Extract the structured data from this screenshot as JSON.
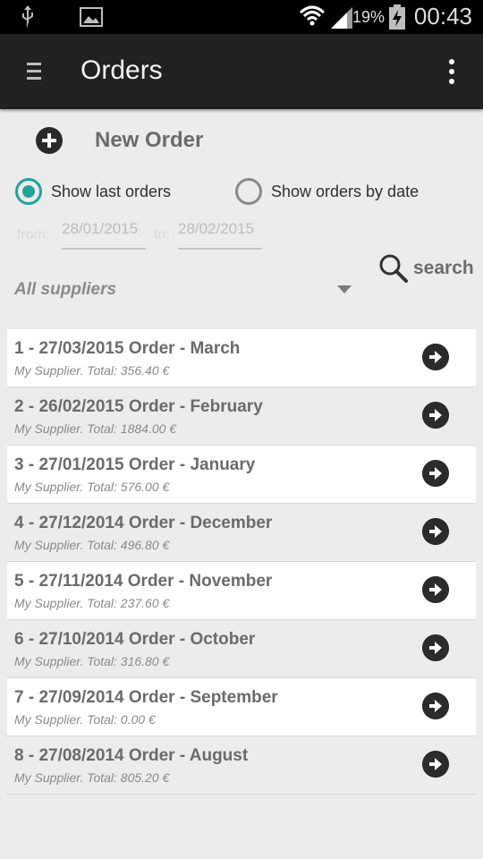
{
  "status_bar": {
    "battery_percent": "19%",
    "time": "00:43",
    "icons": [
      "usb-icon",
      "image-icon",
      "wifi-icon",
      "signal-icon",
      "battery-charging-icon"
    ]
  },
  "action_bar": {
    "title": "Orders",
    "icons": [
      "menu-icon",
      "overflow-menu-icon"
    ]
  },
  "new_order": {
    "label": "New Order",
    "icon": "add-circle-icon"
  },
  "filters": {
    "show_last_label": "Show last orders",
    "show_by_date_label": "Show orders by date",
    "selected": "show_last",
    "from_label": "from:",
    "to_label": "to:",
    "from_value": "28/01/2015",
    "to_value": "28/02/2015",
    "search_label": "search",
    "supplier_value": "All suppliers"
  },
  "colors": {
    "accent": "#21a39a",
    "action_bar": "#212121",
    "background": "#ececec"
  },
  "orders": [
    {
      "title": "1 - 27/03/2015 Order - March",
      "subtitle": "My Supplier. Total: 356.40 €"
    },
    {
      "title": "2 - 26/02/2015 Order - February",
      "subtitle": "My Supplier. Total: 1884.00 €"
    },
    {
      "title": "3 - 27/01/2015 Order - January",
      "subtitle": "My Supplier. Total: 576.00 €"
    },
    {
      "title": "4 - 27/12/2014 Order - December",
      "subtitle": "My Supplier. Total: 496.80 €"
    },
    {
      "title": "5 - 27/11/2014 Order - November",
      "subtitle": "My Supplier. Total: 237.60 €"
    },
    {
      "title": "6 - 27/10/2014 Order - October",
      "subtitle": "My Supplier. Total: 316.80 €"
    },
    {
      "title": "7 - 27/09/2014 Order - September",
      "subtitle": "My Supplier. Total: 0.00 €"
    },
    {
      "title": "8 - 27/08/2014 Order - August",
      "subtitle": "My Supplier. Total: 805.20 €"
    }
  ]
}
